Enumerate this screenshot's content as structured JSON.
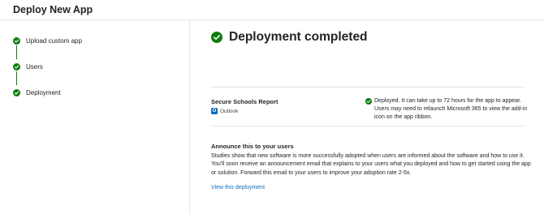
{
  "header": {
    "title": "Deploy New App"
  },
  "steps": [
    {
      "label": "Upload custom app",
      "status": "complete"
    },
    {
      "label": "Users",
      "status": "complete"
    },
    {
      "label": "Deployment",
      "status": "complete"
    }
  ],
  "main": {
    "title": "Deployment completed",
    "app": {
      "name": "Secure Schools Report",
      "host": "Outlook",
      "status_text": "Deployed. It can take up to 72 hours for the app to appear. Users may need to relaunch Microsoft 365 to view the add-in icon on the app ribbon."
    },
    "announce": {
      "title": "Announce this to your users",
      "body": "Studies show that new software is more successfully adopted when users are informed about the software and how to use it. You'll soon receive an announcement email that explains to your users what you deployed and how to get started using the app or solution. Forward this email to your users to improve your adoption rate 2-5x.",
      "link": "View this deployment"
    }
  },
  "colors": {
    "success": "#107c10",
    "link": "#0f6cbd",
    "divider": "#e6e6e6"
  }
}
